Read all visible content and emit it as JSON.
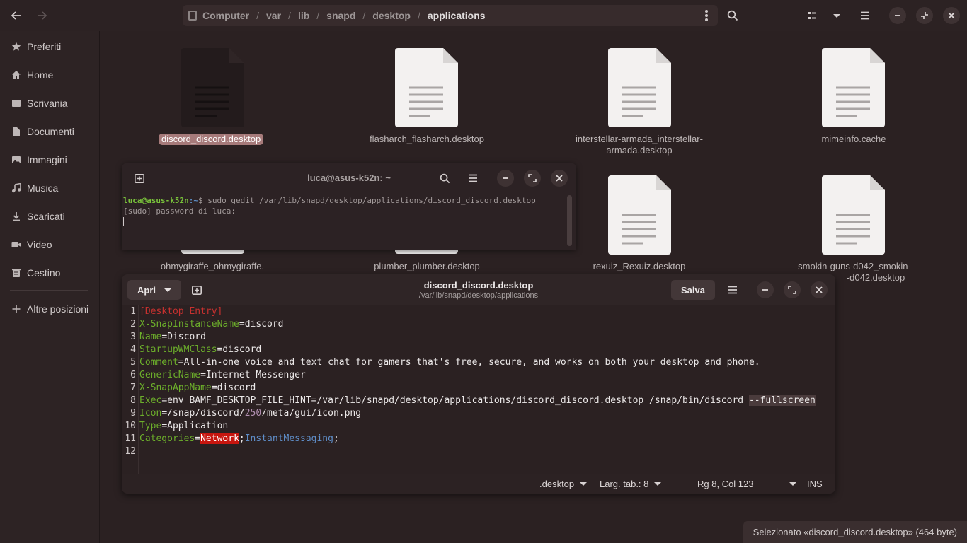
{
  "nautilus": {
    "path": [
      "Computer",
      "var",
      "lib",
      "snapd",
      "desktop",
      "applications"
    ],
    "sidebar": [
      {
        "label": "Preferiti",
        "icon": "star-icon"
      },
      {
        "label": "Home",
        "icon": "home-icon"
      },
      {
        "label": "Scrivania",
        "icon": "desktop-icon"
      },
      {
        "label": "Documenti",
        "icon": "document-icon"
      },
      {
        "label": "Immagini",
        "icon": "image-icon"
      },
      {
        "label": "Musica",
        "icon": "music-icon"
      },
      {
        "label": "Scaricati",
        "icon": "download-icon"
      },
      {
        "label": "Video",
        "icon": "video-icon"
      },
      {
        "label": "Cestino",
        "icon": "trash-icon"
      },
      {
        "label": "Altre posizioni",
        "icon": "plus-icon"
      }
    ],
    "files": [
      {
        "name": "discord_discord.desktop",
        "selected": true
      },
      {
        "name": "flasharch_flasharch.desktop"
      },
      {
        "name": "interstellar-armada_interstellar-armada.desktop",
        "line1": "interstellar-armada_interstellar-",
        "line2": "armada.desktop"
      },
      {
        "name": "mimeinfo.cache"
      },
      {
        "name": "ohmygiraffe_ohmygiraffe."
      },
      {
        "name": "plumber_plumber.desktop"
      },
      {
        "name": "rexuiz_Rexuiz.desktop"
      },
      {
        "name": "smokin-guns-d042_smokin-guns-d042.desktop",
        "line1": "smokin-guns-d042_smokin-",
        "line2": "-d042.desktop"
      }
    ],
    "status": "Selezionato «discord_discord.desktop»  (464 byte)"
  },
  "terminal": {
    "title": "luca@asus-k52n: ~",
    "prompt_user": "luca@asus-k52n",
    "prompt_path": ":~",
    "prompt_symbol": "$",
    "command": " sudo gedit /var/lib/snapd/desktop/applications/discord_discord.desktop",
    "output": "[sudo] password di luca:"
  },
  "gedit": {
    "open_label": "Apri",
    "save_label": "Salva",
    "title": "discord_discord.desktop",
    "subtitle": "/var/lib/snapd/desktop/applications",
    "lines": [
      [
        {
          "t": "[Desktop Entry]",
          "c": "k-sec"
        }
      ],
      [
        {
          "t": "X-SnapInstanceName",
          "c": "k-key"
        },
        {
          "t": "=discord"
        }
      ],
      [
        {
          "t": "Name",
          "c": "k-key"
        },
        {
          "t": "=Discord"
        }
      ],
      [
        {
          "t": "StartupWMClass",
          "c": "k-key"
        },
        {
          "t": "=discord"
        }
      ],
      [
        {
          "t": "Comment",
          "c": "k-key"
        },
        {
          "t": "=All-in-one voice and text chat for gamers that's free, secure, and works on both your desktop and phone."
        }
      ],
      [
        {
          "t": "GenericName",
          "c": "k-key"
        },
        {
          "t": "=Internet Messenger"
        }
      ],
      [
        {
          "t": "X-SnapAppName",
          "c": "k-key"
        },
        {
          "t": "=discord"
        }
      ],
      [
        {
          "t": "Exec",
          "c": "k-key"
        },
        {
          "t": "=env BAMF_DESKTOP_FILE_HINT=/var/lib/snapd/desktop/applications/discord_discord.desktop /snap/bin/discord "
        },
        {
          "t": "--fullscreen",
          "c": "k-hl"
        }
      ],
      [
        {
          "t": "Icon",
          "c": "k-key"
        },
        {
          "t": "=/snap/discord/"
        },
        {
          "t": "250",
          "c": "k-num"
        },
        {
          "t": "/meta/gui/icon.png"
        }
      ],
      [
        {
          "t": "Type",
          "c": "k-key"
        },
        {
          "t": "=Application"
        }
      ],
      [
        {
          "t": "Categories",
          "c": "k-key"
        },
        {
          "t": "="
        },
        {
          "t": "Network",
          "c": "k-err"
        },
        {
          "t": ";"
        },
        {
          "t": "InstantMessaging",
          "c": "k-blue"
        },
        {
          "t": ";"
        }
      ],
      []
    ],
    "statusbar": {
      "language": ".desktop",
      "tab_width": "Larg. tab.: 8",
      "position": "Rg 8, Col 123",
      "mode": "INS"
    }
  }
}
